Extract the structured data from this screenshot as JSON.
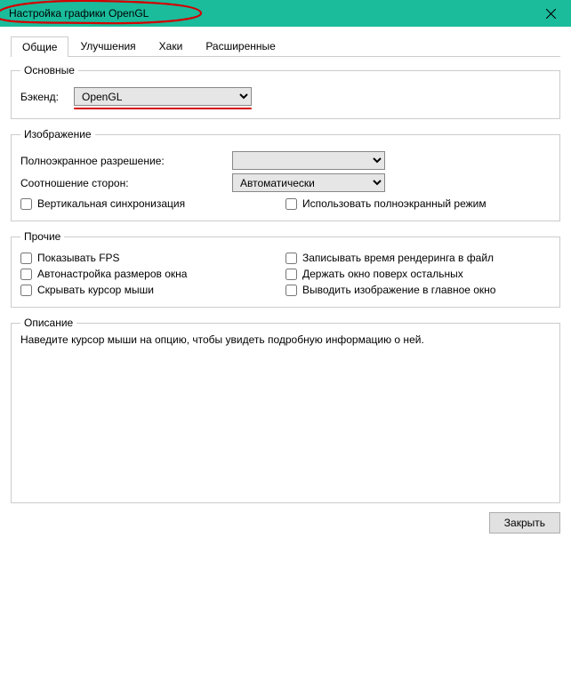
{
  "window": {
    "title": "Настройка графики OpenGL"
  },
  "tabs": {
    "t0": "Общие",
    "t1": "Улучшения",
    "t2": "Хаки",
    "t3": "Расширенные"
  },
  "basic": {
    "legend": "Основные",
    "backend_label": "Бэкенд:",
    "backend_value": "OpenGL"
  },
  "display": {
    "legend": "Изображение",
    "fullres_label": "Полноэкранное разрешение:",
    "fullres_value": "",
    "aspect_label": "Соотношение сторон:",
    "aspect_value": "Автоматически",
    "vsync_label": "Вертикальная синхронизация",
    "fullscreen_label": "Использовать полноэкранный режим"
  },
  "other": {
    "legend": "Прочие",
    "show_fps": "Показывать FPS",
    "log_render": "Записывать время рендеринга в файл",
    "auto_window": "Автонастройка размеров окна",
    "keep_top": "Держать окно поверх остальных",
    "hide_cursor": "Скрывать курсор мыши",
    "render_main": "Выводить изображение в главное окно"
  },
  "description": {
    "legend": "Описание",
    "text": "Наведите курсор мыши на опцию, чтобы увидеть подробную информацию о ней."
  },
  "footer": {
    "close": "Закрыть"
  }
}
